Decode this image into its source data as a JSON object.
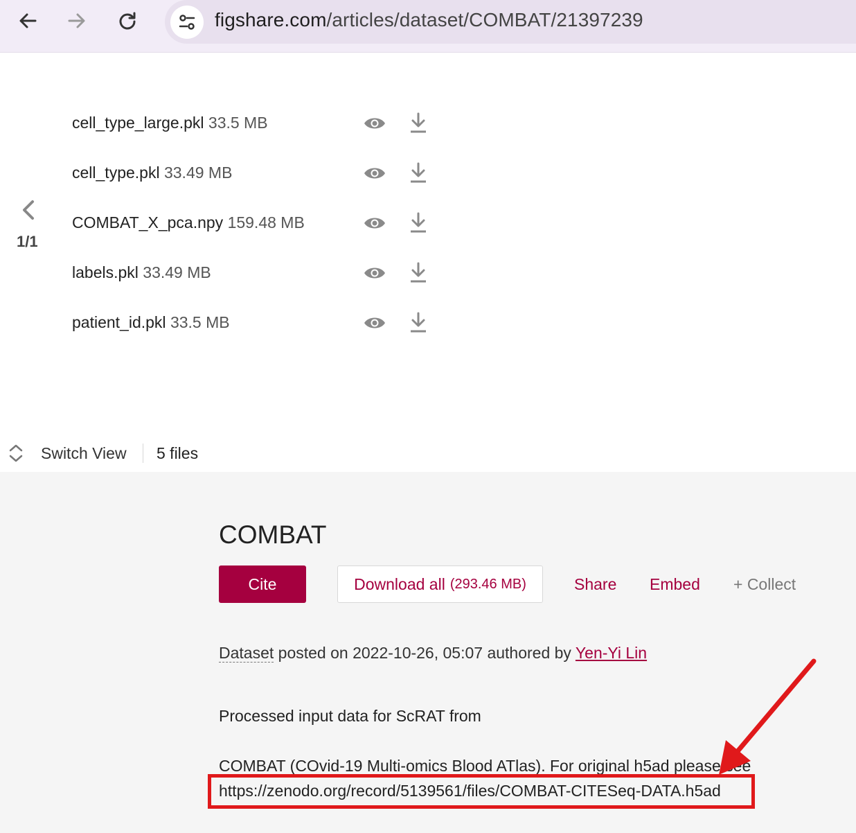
{
  "browser": {
    "url_domain": "figshare.com",
    "url_path": "/articles/dataset/COMBAT/21397239",
    "icons": [
      "back-arrow-icon",
      "forward-arrow-icon",
      "reload-icon",
      "site-info-icon"
    ]
  },
  "viewer": {
    "pager": "1/1",
    "files": [
      {
        "name": "cell_type_large.pkl",
        "size": "33.5 MB"
      },
      {
        "name": "cell_type.pkl",
        "size": "33.49 MB"
      },
      {
        "name": "COMBAT_X_pca.npy",
        "size": "159.48 MB"
      },
      {
        "name": "labels.pkl",
        "size": "33.49 MB"
      },
      {
        "name": "patient_id.pkl",
        "size": "33.5 MB"
      }
    ],
    "switch_view_label": "Switch View",
    "files_count": "5 files"
  },
  "details": {
    "title": "COMBAT",
    "cite_label": "Cite",
    "download_label": "Download all",
    "download_size": "(293.46 MB)",
    "share_label": "Share",
    "embed_label": "Embed",
    "collect_label": "+ Collect",
    "item_type": "Dataset",
    "posted_text": " posted on 2022-10-26, 05:07 authored by ",
    "author": "Yen-Yi Lin",
    "description_line1": "Processed input data for ScRAT from",
    "description_line2": "COMBAT (COvid-19 Multi-omics Blood ATlas). For original h5ad please see",
    "description_link": "https://zenodo.org/record/5139561/files/COMBAT-CITESeq-DATA.h5ad"
  },
  "colors": {
    "accent": "#a5003f",
    "annotation_red": "#e0191b",
    "browser_bar": "#f2ecf7"
  }
}
